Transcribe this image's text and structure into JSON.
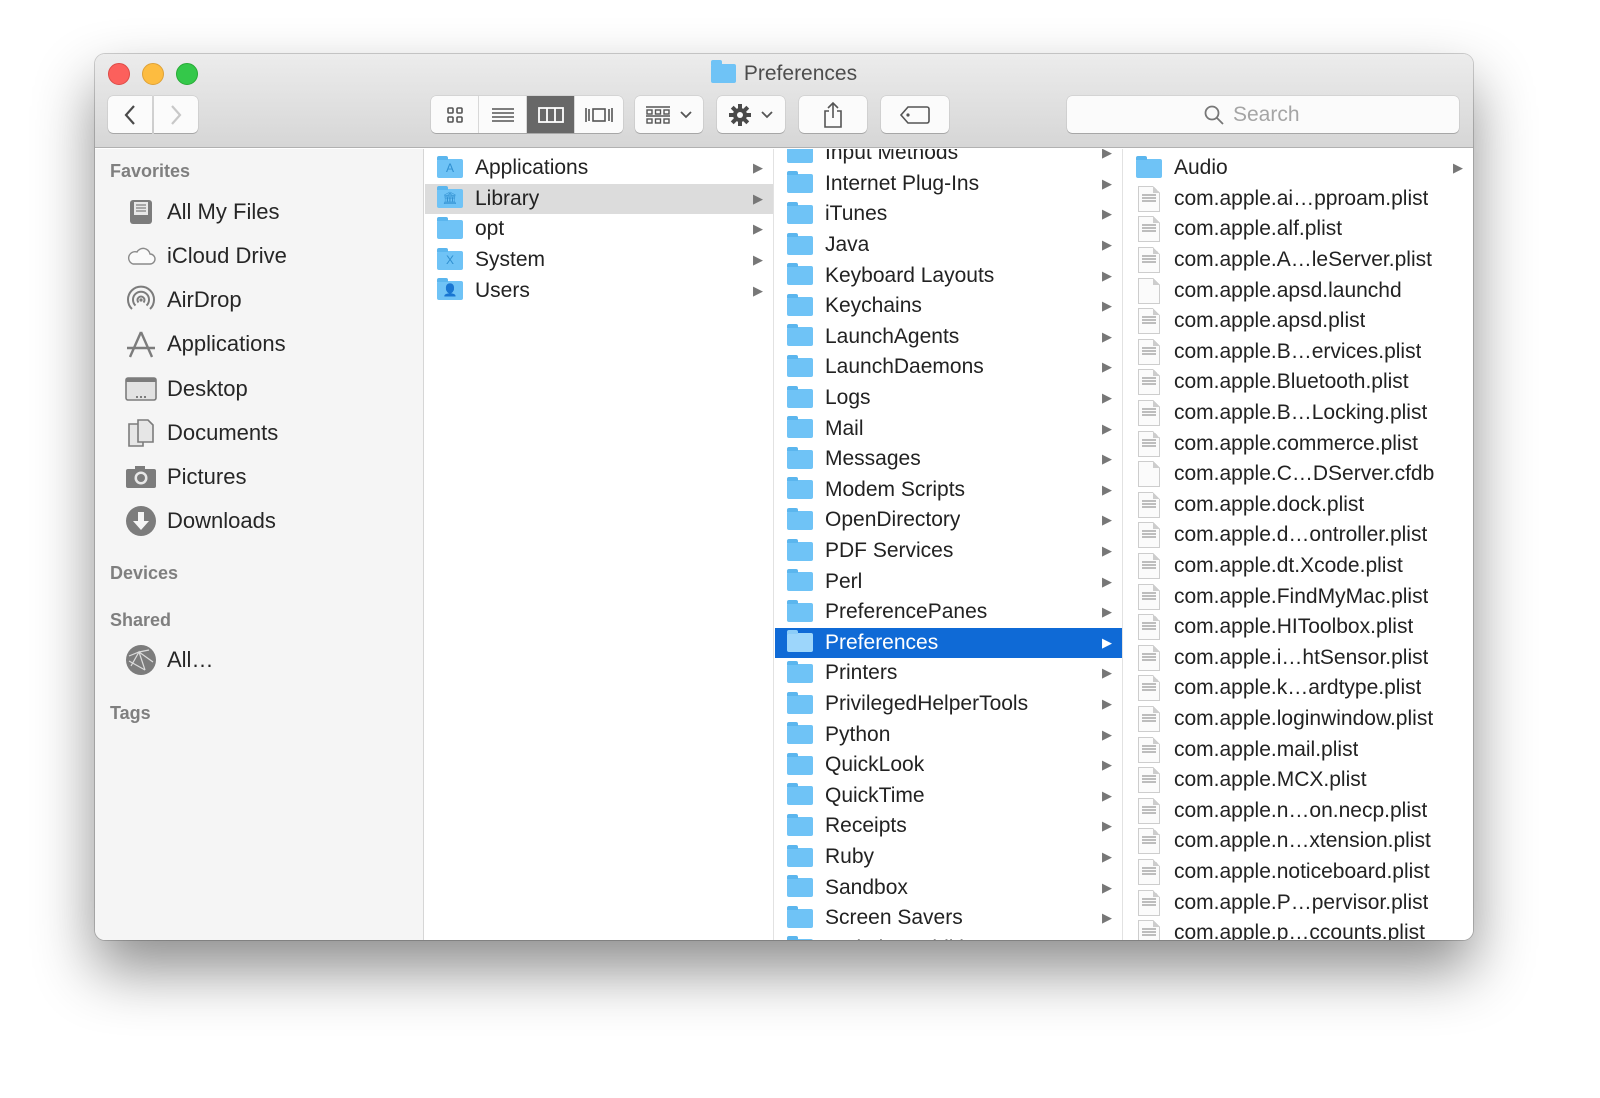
{
  "window": {
    "title": "Preferences"
  },
  "toolbar": {
    "back_label": "Back",
    "forward_label": "Forward",
    "view_modes": [
      "icon-view",
      "list-view",
      "column-view",
      "cover-flow-view"
    ],
    "active_view": "column-view",
    "arrange_label": "Arrange",
    "action_label": "Action",
    "share_label": "Share",
    "tags_label": "Edit Tags",
    "search_placeholder": "Search"
  },
  "sidebar": {
    "favorites_header": "Favorites",
    "favorites": [
      {
        "label": "All My Files",
        "icon": "all-my-files-icon"
      },
      {
        "label": "iCloud Drive",
        "icon": "cloud-icon"
      },
      {
        "label": "AirDrop",
        "icon": "airdrop-icon"
      },
      {
        "label": "Applications",
        "icon": "applications-icon"
      },
      {
        "label": "Desktop",
        "icon": "desktop-icon"
      },
      {
        "label": "Documents",
        "icon": "documents-icon"
      },
      {
        "label": "Pictures",
        "icon": "camera-icon"
      },
      {
        "label": "Downloads",
        "icon": "download-icon"
      }
    ],
    "devices_header": "Devices",
    "shared_header": "Shared",
    "shared": [
      {
        "label": "All…",
        "icon": "network-globe-icon"
      }
    ],
    "tags_header": "Tags"
  },
  "columns": {
    "col1": [
      {
        "label": "Applications",
        "glyph": "A"
      },
      {
        "label": "Library",
        "glyph": "🏛",
        "selected": "inactive"
      },
      {
        "label": "opt",
        "glyph": ""
      },
      {
        "label": "System",
        "glyph": "X"
      },
      {
        "label": "Users",
        "glyph": "👤"
      }
    ],
    "col2": [
      "Input Methods",
      "Internet Plug-Ins",
      "iTunes",
      "Java",
      "Keyboard Layouts",
      "Keychains",
      "LaunchAgents",
      "LaunchDaemons",
      "Logs",
      "Mail",
      "Messages",
      "Modem Scripts",
      "OpenDirectory",
      "PDF Services",
      "Perl",
      "PreferencePanes",
      "Preferences",
      "Printers",
      "PrivilegedHelperTools",
      "Python",
      "QuickLook",
      "QuickTime",
      "Receipts",
      "Ruby",
      "Sandbox",
      "Screen Savers",
      "Scripting Additions"
    ],
    "col2_selected": "Preferences",
    "col3": [
      {
        "label": "Audio",
        "type": "folder"
      },
      {
        "label": "com.apple.ai…pproam.plist",
        "type": "plist"
      },
      {
        "label": "com.apple.alf.plist",
        "type": "plist"
      },
      {
        "label": "com.apple.A…leServer.plist",
        "type": "plist"
      },
      {
        "label": "com.apple.apsd.launchd",
        "type": "file"
      },
      {
        "label": "com.apple.apsd.plist",
        "type": "plist"
      },
      {
        "label": "com.apple.B…ervices.plist",
        "type": "plist"
      },
      {
        "label": "com.apple.Bluetooth.plist",
        "type": "plist"
      },
      {
        "label": "com.apple.B…Locking.plist",
        "type": "plist"
      },
      {
        "label": "com.apple.commerce.plist",
        "type": "plist"
      },
      {
        "label": "com.apple.C…DServer.cfdb",
        "type": "file"
      },
      {
        "label": "com.apple.dock.plist",
        "type": "plist"
      },
      {
        "label": "com.apple.d…ontroller.plist",
        "type": "plist"
      },
      {
        "label": "com.apple.dt.Xcode.plist",
        "type": "plist"
      },
      {
        "label": "com.apple.FindMyMac.plist",
        "type": "plist"
      },
      {
        "label": "com.apple.HIToolbox.plist",
        "type": "plist"
      },
      {
        "label": "com.apple.i…htSensor.plist",
        "type": "plist"
      },
      {
        "label": "com.apple.k…ardtype.plist",
        "type": "plist"
      },
      {
        "label": "com.apple.loginwindow.plist",
        "type": "plist"
      },
      {
        "label": "com.apple.mail.plist",
        "type": "plist"
      },
      {
        "label": "com.apple.MCX.plist",
        "type": "plist"
      },
      {
        "label": "com.apple.n…on.necp.plist",
        "type": "plist"
      },
      {
        "label": "com.apple.n…xtension.plist",
        "type": "plist"
      },
      {
        "label": "com.apple.noticeboard.plist",
        "type": "plist"
      },
      {
        "label": "com.apple.P…pervisor.plist",
        "type": "plist"
      },
      {
        "label": "com.apple.p…ccounts.plist",
        "type": "plist"
      }
    ]
  },
  "colors": {
    "selection_blue": "#0f6ad6",
    "selection_gray": "#dcdcdc",
    "folder_blue": "#6fc3f6",
    "close": "#fc605c",
    "minimize": "#fdbc40",
    "maximize": "#34c84a"
  }
}
